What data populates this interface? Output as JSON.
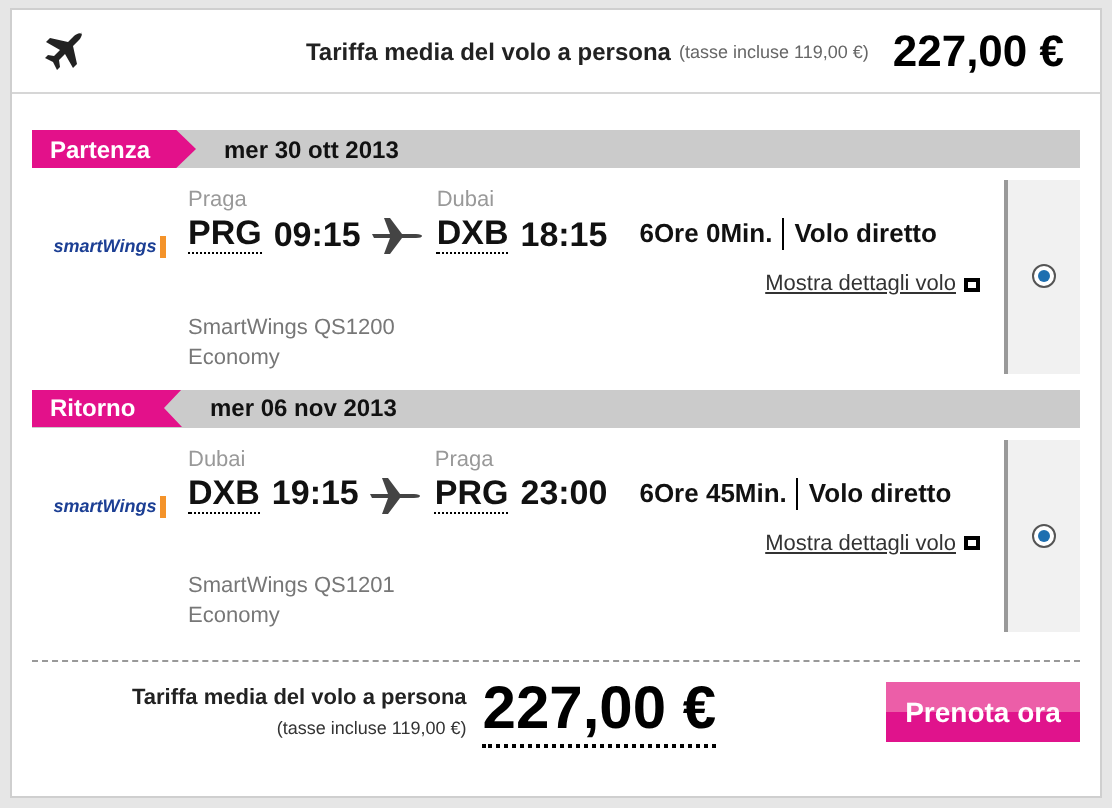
{
  "header": {
    "label": "Tariffa media del volo a persona",
    "taxes": "(tasse incluse 119,00 €)",
    "price": "227,00 €"
  },
  "segments": [
    {
      "kind": "outbound",
      "tag": "Partenza",
      "date": "mer 30 ott 2013",
      "logo": "smartWings",
      "from_city": "Praga",
      "from_code": "PRG",
      "from_time": "09:15",
      "to_city": "Dubai",
      "to_code": "DXB",
      "to_time": "18:15",
      "duration": "6Ore 0Min.",
      "direct": "Volo diretto",
      "details_link": "Mostra dettagli volo",
      "flight": "SmartWings QS1200",
      "cabin": "Economy",
      "selected": true
    },
    {
      "kind": "return",
      "tag": "Ritorno",
      "date": "mer 06 nov 2013",
      "logo": "smartWings",
      "from_city": "Dubai",
      "from_code": "DXB",
      "from_time": "19:15",
      "to_city": "Praga",
      "to_code": "PRG",
      "to_time": "23:00",
      "duration": "6Ore 45Min.",
      "direct": "Volo diretto",
      "details_link": "Mostra dettagli volo",
      "flight": "SmartWings QS1201",
      "cabin": "Economy",
      "selected": true
    }
  ],
  "footer": {
    "label": "Tariffa media del volo a persona",
    "taxes": "(tasse incluse 119,00 €)",
    "price": "227,00 €",
    "button": "Prenota ora"
  }
}
